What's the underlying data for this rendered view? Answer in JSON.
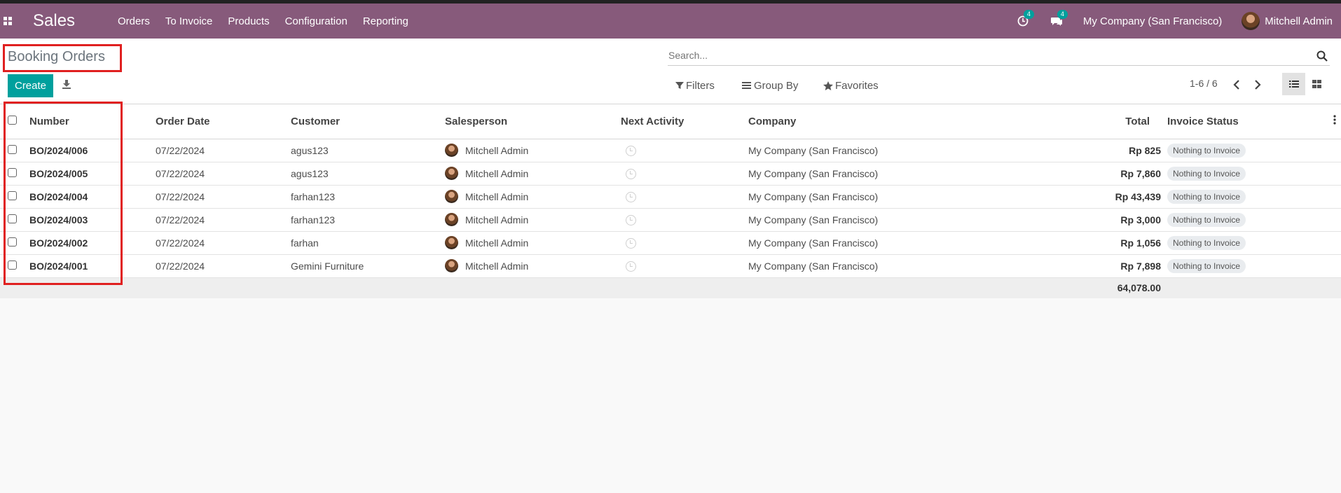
{
  "navbar": {
    "app_name": "Sales",
    "menu": [
      "Orders",
      "To Invoice",
      "Products",
      "Configuration",
      "Reporting"
    ],
    "activity_badge": "4",
    "messages_badge": "4",
    "company": "My Company (San Francisco)",
    "user": "Mitchell Admin"
  },
  "control_panel": {
    "title": "Booking Orders",
    "create_label": "Create",
    "search_placeholder": "Search...",
    "filters_label": "Filters",
    "groupby_label": "Group By",
    "favorites_label": "Favorites",
    "pager": "1-6 / 6"
  },
  "table": {
    "headers": {
      "number": "Number",
      "order_date": "Order Date",
      "customer": "Customer",
      "salesperson": "Salesperson",
      "next_activity": "Next Activity",
      "company": "Company",
      "total": "Total",
      "invoice_status": "Invoice Status"
    },
    "rows": [
      {
        "number": "BO/2024/006",
        "date": "07/22/2024",
        "customer": "agus123",
        "salesperson": "Mitchell Admin",
        "company": "My Company (San Francisco)",
        "total": "Rp 825",
        "status": "Nothing to Invoice"
      },
      {
        "number": "BO/2024/005",
        "date": "07/22/2024",
        "customer": "agus123",
        "salesperson": "Mitchell Admin",
        "company": "My Company (San Francisco)",
        "total": "Rp 7,860",
        "status": "Nothing to Invoice"
      },
      {
        "number": "BO/2024/004",
        "date": "07/22/2024",
        "customer": "farhan123",
        "salesperson": "Mitchell Admin",
        "company": "My Company (San Francisco)",
        "total": "Rp 43,439",
        "status": "Nothing to Invoice"
      },
      {
        "number": "BO/2024/003",
        "date": "07/22/2024",
        "customer": "farhan123",
        "salesperson": "Mitchell Admin",
        "company": "My Company (San Francisco)",
        "total": "Rp 3,000",
        "status": "Nothing to Invoice"
      },
      {
        "number": "BO/2024/002",
        "date": "07/22/2024",
        "customer": "farhan",
        "salesperson": "Mitchell Admin",
        "company": "My Company (San Francisco)",
        "total": "Rp 1,056",
        "status": "Nothing to Invoice"
      },
      {
        "number": "BO/2024/001",
        "date": "07/22/2024",
        "customer": "Gemini Furniture",
        "salesperson": "Mitchell Admin",
        "company": "My Company (San Francisco)",
        "total": "Rp 7,898",
        "status": "Nothing to Invoice"
      }
    ],
    "sum_total": "64,078.00"
  },
  "colors": {
    "navbar": "#875a7b",
    "primary_button": "#00a09d",
    "highlight_box": "#e02020"
  },
  "icons": [
    "apps-grid-icon",
    "activity-clock-icon",
    "chat-icon",
    "download-icon",
    "search-icon",
    "filter-icon",
    "group-by-icon",
    "star-icon",
    "chevron-left-icon",
    "chevron-right-icon",
    "list-view-icon",
    "kanban-view-icon",
    "clock-icon",
    "kebab-icon"
  ]
}
